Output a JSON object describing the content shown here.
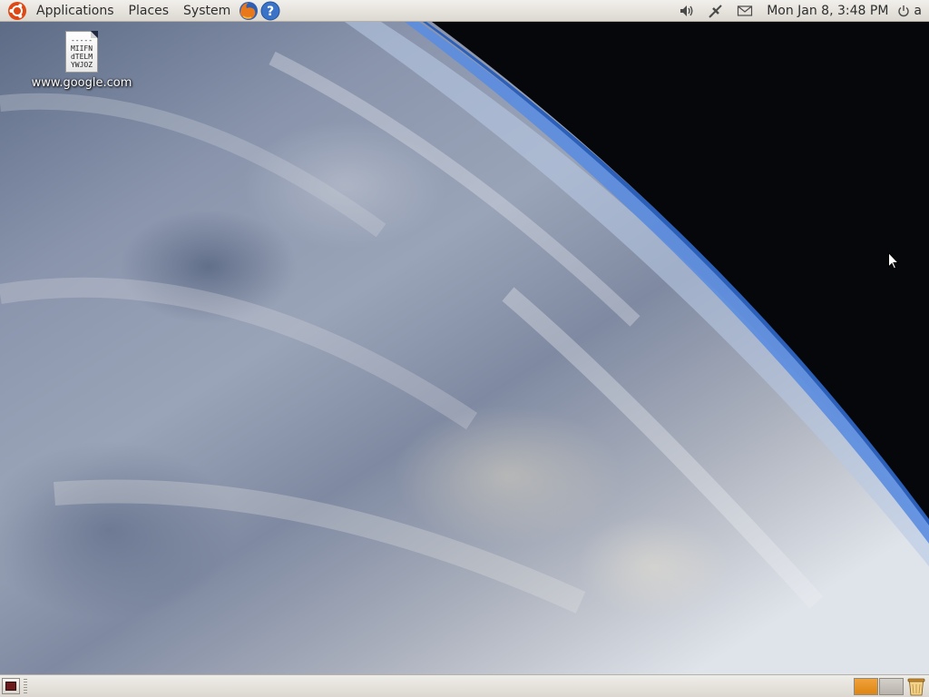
{
  "top_panel": {
    "menus": [
      "Applications",
      "Places",
      "System"
    ],
    "launchers": [
      "firefox-icon",
      "help-icon"
    ],
    "tray_icons": [
      "volume-icon",
      "network-icon",
      "mail-icon"
    ],
    "clock": "Mon Jan  8,  3:48 PM",
    "user": "a"
  },
  "desktop": {
    "icon": {
      "label": "www.google.com",
      "preview_lines": [
        "-----",
        "MIIFN",
        "dTELM",
        "YWJOZ"
      ]
    }
  },
  "bottom_panel": {
    "workspaces": [
      "workspace-1",
      "workspace-2"
    ],
    "active_workspace": 1
  },
  "colors": {
    "panel": "#dcd8d1",
    "active_workspace": "#e8901f"
  }
}
